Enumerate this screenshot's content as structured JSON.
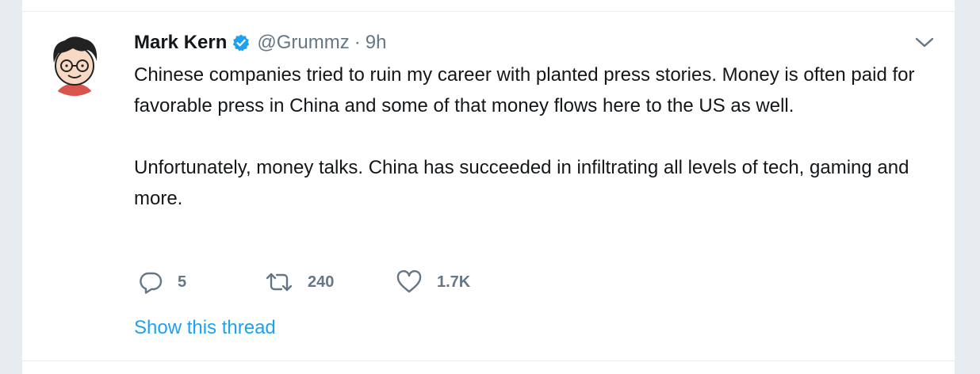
{
  "tweet": {
    "author_name": "Mark Kern",
    "handle": "@Grummz",
    "separator": "·",
    "time": "9h",
    "paragraphs": [
      "Chinese companies tried to ruin my career with planted press stories. Money is often paid for favorable press in China and some of that money flows here to the US as well.",
      "Unfortunately, money talks. China has succeeded in infiltrating all levels of tech, gaming and more."
    ],
    "actions": {
      "reply_count": "5",
      "retweet_count": "240",
      "like_count": "1.7K"
    },
    "thread_link": "Show this thread"
  },
  "icons": {
    "verified": "verified-badge-icon",
    "caret": "chevron-down-icon",
    "reply": "reply-bubble-icon",
    "retweet": "retweet-arrows-icon",
    "like": "heart-icon"
  },
  "colors": {
    "text_primary": "#14171a",
    "text_secondary": "#657786",
    "link_blue": "#1da1f2",
    "background": "#e6ecf0",
    "card": "#ffffff"
  }
}
